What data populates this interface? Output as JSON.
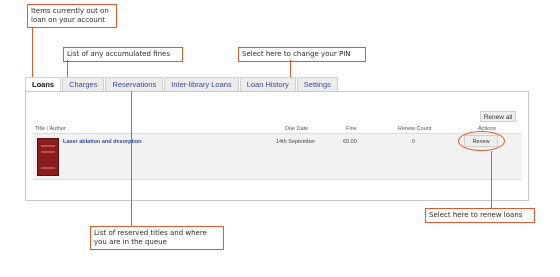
{
  "callouts": {
    "out_on_loan": "Items currently out on loan on your account",
    "fines": "List of any accumulated fines",
    "pin": "Select here to change your PIN",
    "reserved": "List of reserved titles and where you are in the queue",
    "renew": "Select here to renew loans"
  },
  "tabs": [
    {
      "label": "Loans",
      "active": true
    },
    {
      "label": "Charges",
      "active": false
    },
    {
      "label": "Reservations",
      "active": false
    },
    {
      "label": "Inter-library Loans",
      "active": false
    },
    {
      "label": "Loan History",
      "active": false
    },
    {
      "label": "Settings",
      "active": false
    }
  ],
  "actions": {
    "renew_all": "Renew all"
  },
  "table": {
    "headers": {
      "title_author": "Title / Author",
      "due_date": "Due Date",
      "fine": "Fine",
      "renew_count": "Renew Count",
      "actions": "Actions"
    },
    "rows": [
      {
        "title": "Laser ablation and desorption",
        "due_date": "14th September",
        "fine": "€0.00",
        "renew_count": "0",
        "action": "Renew"
      }
    ]
  },
  "colors": {
    "accent": "#e05a2b",
    "link": "#3a4a9a",
    "cover": "#8a1d1d"
  }
}
